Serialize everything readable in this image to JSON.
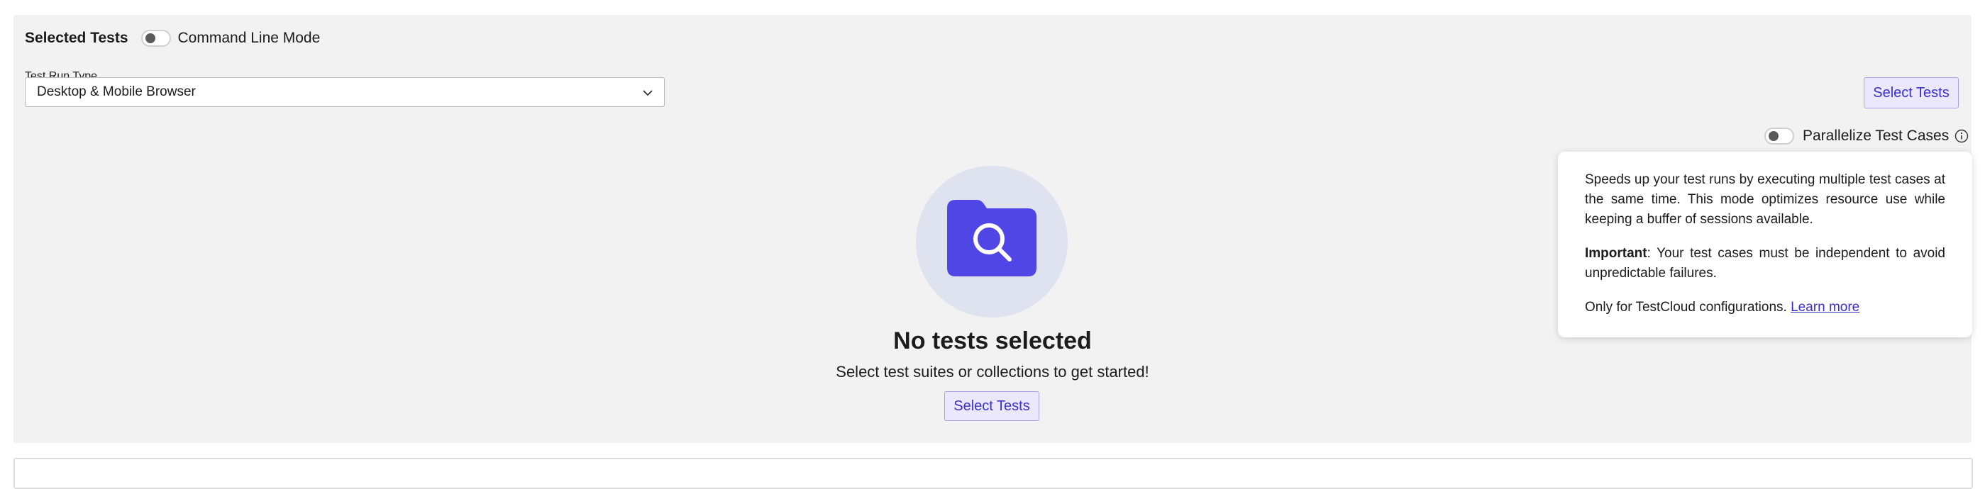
{
  "header": {
    "title": "Selected Tests",
    "command_line_mode_label": "Command Line Mode"
  },
  "test_run_type": {
    "label": "Test Run Type",
    "selected": "Desktop & Mobile Browser"
  },
  "select_tests_button_top": "Select Tests",
  "parallelize": {
    "label": "Parallelize Test Cases",
    "enabled": false
  },
  "tooltip": {
    "paragraph1": "Speeds up your test runs by executing multiple test cases at the same time. This mode optimizes resource use while keeping a buffer of sessions available.",
    "important_label": "Important",
    "important_text": ": Your test cases must be independent to avoid unpredictable failures.",
    "paragraph3_text": "Only for TestCloud configurations.",
    "learn_more": "Learn more"
  },
  "empty_state": {
    "title": "No tests selected",
    "subtitle": "Select test suites or collections to get started!",
    "button": "Select Tests"
  },
  "colors": {
    "accent": "#4f46e5",
    "accent_text": "#3b2fc9",
    "panel_bg": "#f2f2f2",
    "illustration_bg": "#dfe3f0"
  },
  "icons": {
    "folder": "folder-search-icon",
    "info": "info-icon",
    "chevron": "chevron-down-icon"
  }
}
